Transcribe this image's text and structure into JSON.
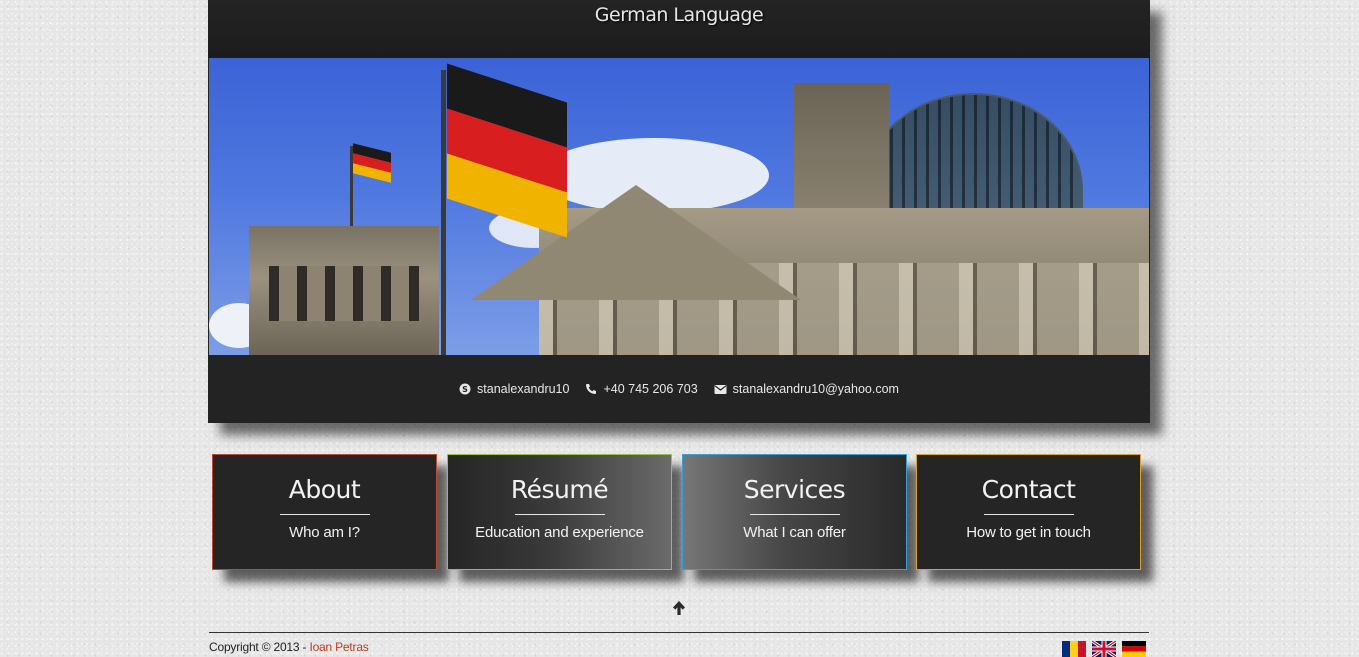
{
  "header": {
    "title": "German Language"
  },
  "contact": {
    "skype": "stanalexandru10",
    "phone": "+40 745 206 703",
    "email": "stanalexandru10@yahoo.com"
  },
  "tiles": [
    {
      "title": "About",
      "subtitle": "Who am I?",
      "accent": "#c24a2c"
    },
    {
      "title": "Résumé",
      "subtitle": "Education and experience",
      "accent": "#9ac038"
    },
    {
      "title": "Services",
      "subtitle": "What I can offer",
      "accent": "#2ea4d8"
    },
    {
      "title": "Contact",
      "subtitle": "How to get in touch",
      "accent": "#d9a22c"
    }
  ],
  "footer": {
    "copyright_prefix": "Copyright © 2013 -",
    "author": "Ioan Petras",
    "author_color": "#c23a1f",
    "back_to_top_icon": "arrow-up-icon",
    "language_flags": [
      "romanian-flag-icon",
      "uk-flag-icon",
      "german-flag-icon"
    ]
  },
  "colors": {
    "background": "#e6e6e6",
    "panel": "#232323"
  }
}
